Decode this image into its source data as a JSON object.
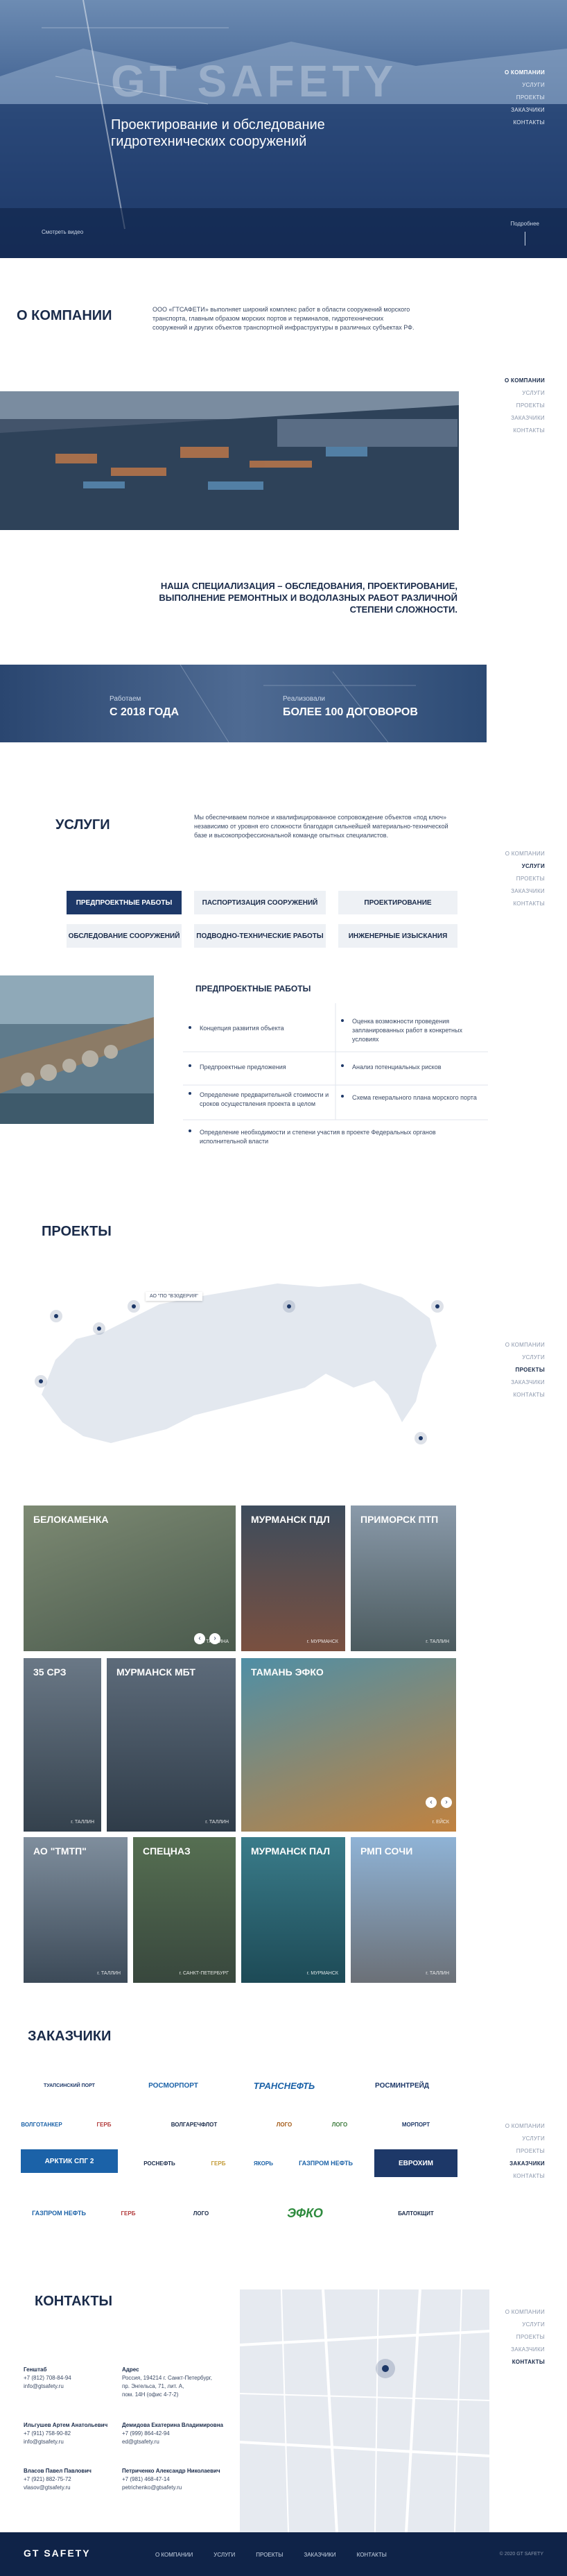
{
  "brand": {
    "logo": "GT SAFETY",
    "footer_logo": "GT SAFETY"
  },
  "nav": {
    "items": [
      "О КОМПАНИИ",
      "УСЛУГИ",
      "ПРОЕКТЫ",
      "ЗАКАЗЧИКИ",
      "КОНТАКТЫ"
    ]
  },
  "hero": {
    "title": "Проектирование и обследование гидротехнических сооружений",
    "scroll_left": "Смотреть видео",
    "scroll_right": "Подробнее"
  },
  "about": {
    "title": "О КОМПАНИИ",
    "text": "ООО «ГТСАФЕТИ» выполняет широкий комплекс работ в области сооружений морского транспорта, главным образом морских портов и терминалов, гидротехнических сооружений и других объектов транспортной инфраструктуры в различных субъектах РФ.",
    "specialization": "НАША СПЕЦИАЛИЗАЦИЯ – ОБСЛЕДОВАНИЯ, ПРОЕКТИРОВАНИЕ, ВЫПОЛНЕНИЕ РЕМОНТНЫХ И ВОДОЛАЗНЫХ РАБОТ РАЗЛИЧНОЙ СТЕПЕНИ СЛОЖНОСТИ.",
    "stat1_label": "Работаем",
    "stat1_value": "С 2018 ГОДА",
    "stat2_label": "Реализовали",
    "stat2_value": "БОЛЕЕ 100 ДОГОВОРОВ"
  },
  "services": {
    "title": "УСЛУГИ",
    "intro": "Мы обеспечиваем полное и квалифицированное сопровождение объектов «под ключ» независимо от уровня его сложности благодаря сильнейшей материально-технической базе и высокопрофессиональной команде опытных специалистов.",
    "buttons": [
      "ПРЕДПРОЕКТНЫЕ РАБОТЫ",
      "ПАСПОРТИЗАЦИЯ СООРУЖЕНИЙ",
      "ПРОЕКТИРОВАНИЕ",
      "ОБСЛЕДОВАНИЕ СООРУЖЕНИЙ",
      "ПОДВОДНО-ТЕХНИЧЕСКИЕ РАБОТЫ",
      "ИНЖЕНЕРНЫЕ ИЗЫСКАНИЯ"
    ],
    "detail_title": "ПРЕДПРОЕКТНЫЕ РАБОТЫ",
    "detail_items": [
      "Концепция развития объекта",
      "Оценка возможности проведения запланированных работ в конкретных условиях",
      "Предпроектные предложения",
      "Анализ потенциальных рисков",
      "Определение предварительной стоимости и сроков осуществления проекта в целом",
      "Схема генерального плана морского порта",
      "Определение необходимости и степени участия в проекте Федеральных органов исполнительной власти"
    ]
  },
  "projects": {
    "title": "ПРОЕКТЫ",
    "map_label": "АО \"ПО \"ВЭЗДЕРИЯ\"",
    "items": [
      {
        "name": "БЕЛОКАМЕНКА",
        "loc": "г. ТАЛЛИНА"
      },
      {
        "name": "МУРМАНСК ПДЛ",
        "loc": "г. МУРМАНСК"
      },
      {
        "name": "ПРИМОРСК ПТП",
        "loc": "г. ТАЛЛИН"
      },
      {
        "name": "35 СРЗ",
        "loc": "г. ТАЛЛИН"
      },
      {
        "name": "МУРМАНСК МБТ",
        "loc": "г. ТАЛЛИН"
      },
      {
        "name": "ТАМАНЬ ЭФКО",
        "loc": "г. ЕЙСК"
      },
      {
        "name": "АО \"ТМТП\"",
        "loc": "г. ТАЛЛИН"
      },
      {
        "name": "СПЕЦНАЗ",
        "loc": "г. САНКТ-ПЕТЕРБУРГ"
      },
      {
        "name": "МУРМАНСК ПАЛ",
        "loc": "г. МУРМАНСК"
      },
      {
        "name": "РМП СОЧИ",
        "loc": "г. ТАЛЛИН"
      }
    ]
  },
  "clients": {
    "title": "ЗАКАЗЧИКИ",
    "logos": [
      "ТУАПСИНСКИЙ ПОРТ",
      "РОСМОРПОРТ",
      "ТРАНСНЕФТЬ",
      "РОСМИНТРЕЙД",
      "ВОЛГОТАНКЕР",
      "ГЕРБ",
      "ВОЛГАРЕЧФЛОТ",
      "ЛОГО",
      "ЛОГО",
      "МОРПОРТ",
      "АРКТИК СПГ 2",
      "РОСНЕФТЬ",
      "ГЕРБ",
      "ЯКОРЬ",
      "ГАЗПРОМ НЕФТЬ",
      "ЕВРОХИМ",
      "ГАЗПРОМ НЕФТЬ",
      "ГЕРБ",
      "ЛОГО",
      "ЭФКО",
      "БАЛТОКЩИТ"
    ]
  },
  "contacts": {
    "title": "КОНТАКТЫ",
    "blocks": [
      {
        "name": "Генштаб",
        "lines": [
          "+7 (812) 708-84-94",
          "info@gtsafety.ru"
        ]
      },
      {
        "name": "Адрес",
        "lines": [
          "Россия, 194214 г. Санкт-Петербург,",
          "пр. Энгельса, 71, лит. А,",
          "пом. 14Н (офис 4-7-2)"
        ]
      },
      {
        "name": "Ильгушев Артем Анатольевич",
        "lines": [
          "+7 (911) 758-90-82",
          "info@gtsafety.ru"
        ]
      },
      {
        "name": "Демидова Екатерина Владимировна",
        "lines": [
          "+7 (999) 864-42-94",
          "ed@gtsafety.ru"
        ]
      },
      {
        "name": "Власов Павел Павлович",
        "lines": [
          "+7 (921) 882-75-72",
          "vlasov@gtsafety.ru"
        ]
      },
      {
        "name": "Петриченко Александр Николаевич",
        "lines": [
          "+7 (981) 468-47-14",
          "petrichenko@gtsafety.ru"
        ]
      }
    ]
  },
  "footer": {
    "copyright": "© 2020 GT SAFETY"
  }
}
